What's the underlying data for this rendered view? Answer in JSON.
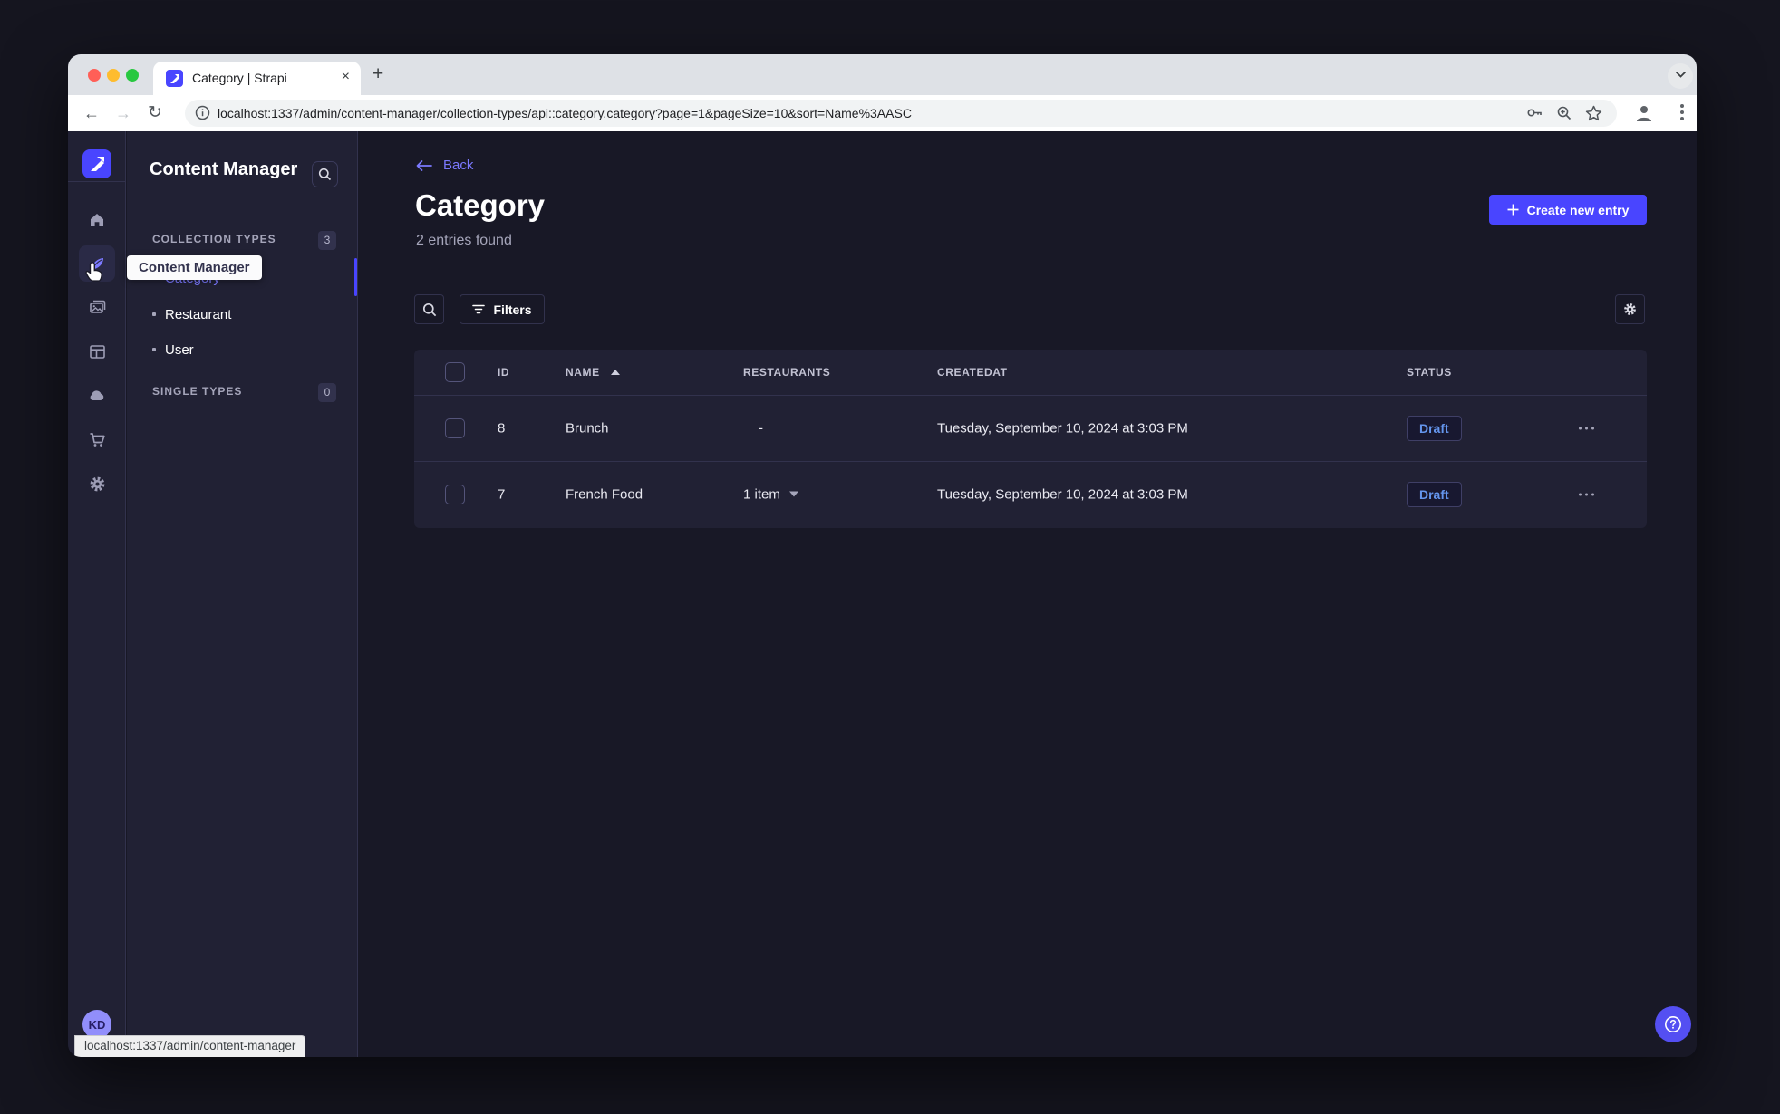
{
  "browser": {
    "tab_title": "Category | Strapi",
    "new_tab_label": "+",
    "close_label": "×",
    "url": "localhost:1337/admin/content-manager/collection-types/api::category.category?page=1&pageSize=10&sort=Name%3AASC",
    "status_tooltip": "localhost:1337/admin/content-manager",
    "back_glyph": "←",
    "forward_glyph": "→",
    "reload_glyph": "↻"
  },
  "rail": {
    "avatar_initials": "KD",
    "tooltip": "Content Manager"
  },
  "subnav": {
    "title": "Content Manager",
    "sections": [
      {
        "label": "COLLECTION TYPES",
        "count": "3"
      },
      {
        "label": "SINGLE TYPES",
        "count": "0"
      }
    ],
    "items": [
      {
        "label": "Category"
      },
      {
        "label": "Restaurant"
      },
      {
        "label": "User"
      }
    ]
  },
  "main": {
    "back_label": "Back",
    "title": "Category",
    "subtitle": "2 entries found",
    "create_button": "Create new entry",
    "filters_button": "Filters",
    "table": {
      "headers": [
        "ID",
        "NAME",
        "RESTAURANTS",
        "CREATEDAT",
        "STATUS"
      ],
      "rows": [
        {
          "id": "8",
          "name": "Brunch",
          "restaurants": "-",
          "createdAt": "Tuesday, September 10, 2024 at 3:03 PM",
          "status": "Draft"
        },
        {
          "id": "7",
          "name": "French Food",
          "restaurants": "1 item",
          "createdAt": "Tuesday, September 10, 2024 at 3:03 PM",
          "status": "Draft"
        }
      ]
    }
  },
  "icons": {
    "strapi-logo": "indigo rounded square with white diagonal band",
    "home-icon": "house",
    "content-manager-icon": "feather pen (active, indigo)",
    "media-library-icon": "picture frames",
    "content-type-builder-icon": "layout window",
    "cloud-icon": "cloud",
    "marketplace-icon": "shopping cart",
    "settings-icon": "gear",
    "search-icon": "magnifier",
    "filter-icon": "three bars",
    "plus-icon": "plus",
    "help-icon": "circled question mark",
    "key-icon": "password key",
    "zoom-icon": "magnifier with plus",
    "star-icon": "bookmark star",
    "profile-icon": "person",
    "kebab-icon": "three vertical dots",
    "info-icon": "circled i",
    "chevron-down-icon": "v",
    "cursor-hand-icon": "pointing hand"
  },
  "colors": {
    "primary": "#4945ff",
    "link": "#7b79ff",
    "surface": "#212134",
    "background": "#181826",
    "border": "#32324d",
    "draft_text": "#6495ed"
  }
}
